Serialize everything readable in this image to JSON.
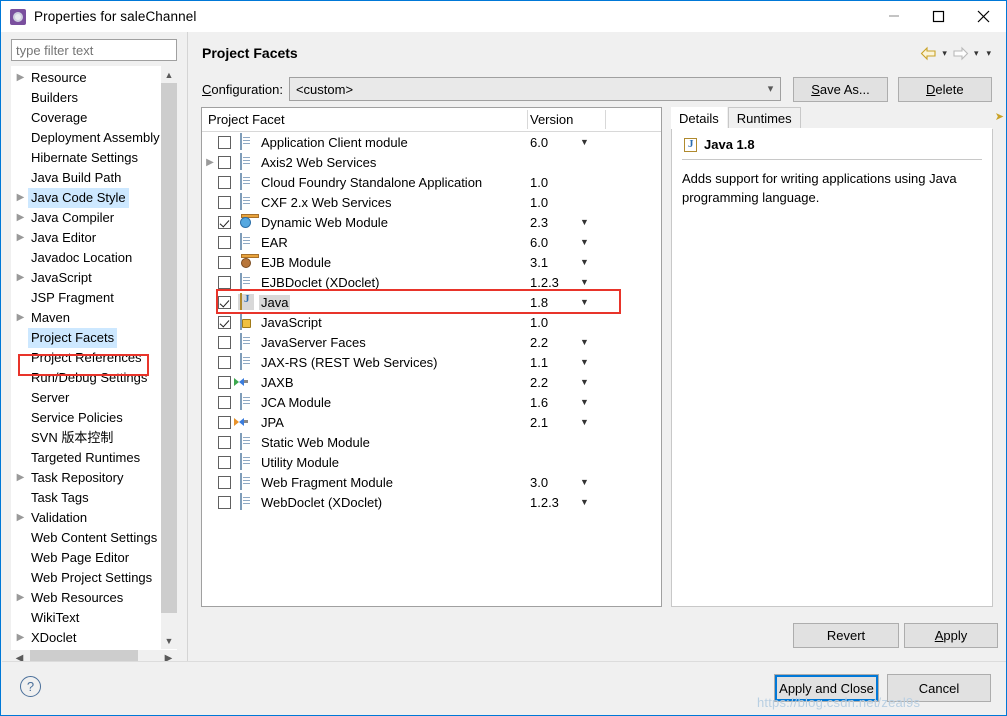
{
  "window": {
    "title": "Properties for saleChannel",
    "icon": "properties-gear-icon",
    "minimize": "minimize-icon",
    "maximize": "maximize-icon",
    "close": "close-icon"
  },
  "sidebar": {
    "filter_placeholder": "type filter text",
    "items": [
      {
        "label": "Resource",
        "expandable": true,
        "selected": false
      },
      {
        "label": "Builders",
        "expandable": false,
        "selected": false
      },
      {
        "label": "Coverage",
        "expandable": false,
        "selected": false
      },
      {
        "label": "Deployment Assembly",
        "expandable": false,
        "selected": false
      },
      {
        "label": "Hibernate Settings",
        "expandable": false,
        "selected": false
      },
      {
        "label": "Java Build Path",
        "expandable": false,
        "selected": false
      },
      {
        "label": "Java Code Style",
        "expandable": true,
        "selected": false,
        "highlight": true
      },
      {
        "label": "Java Compiler",
        "expandable": true,
        "selected": false
      },
      {
        "label": "Java Editor",
        "expandable": true,
        "selected": false
      },
      {
        "label": "Javadoc Location",
        "expandable": false,
        "selected": false
      },
      {
        "label": "JavaScript",
        "expandable": true,
        "selected": false
      },
      {
        "label": "JSP Fragment",
        "expandable": false,
        "selected": false
      },
      {
        "label": "Maven",
        "expandable": true,
        "selected": false
      },
      {
        "label": "Project Facets",
        "expandable": false,
        "selected": true
      },
      {
        "label": "Project References",
        "expandable": false,
        "selected": false
      },
      {
        "label": "Run/Debug Settings",
        "expandable": false,
        "selected": false
      },
      {
        "label": "Server",
        "expandable": false,
        "selected": false
      },
      {
        "label": "Service Policies",
        "expandable": false,
        "selected": false
      },
      {
        "label": "SVN 版本控制",
        "expandable": false,
        "selected": false
      },
      {
        "label": "Targeted Runtimes",
        "expandable": false,
        "selected": false
      },
      {
        "label": "Task Repository",
        "expandable": true,
        "selected": false
      },
      {
        "label": "Task Tags",
        "expandable": false,
        "selected": false
      },
      {
        "label": "Validation",
        "expandable": true,
        "selected": false
      },
      {
        "label": "Web Content Settings",
        "expandable": false,
        "selected": false
      },
      {
        "label": "Web Page Editor",
        "expandable": false,
        "selected": false
      },
      {
        "label": "Web Project Settings",
        "expandable": false,
        "selected": false
      },
      {
        "label": "Web Resources",
        "expandable": true,
        "selected": false
      },
      {
        "label": "WikiText",
        "expandable": false,
        "selected": false
      },
      {
        "label": "XDoclet",
        "expandable": true,
        "selected": false
      }
    ],
    "scroll_up_icon": "chevron-up-icon",
    "scroll_down_icon": "chevron-down-icon",
    "scroll_left_icon": "chevron-left-icon",
    "scroll_right_icon": "chevron-right-icon"
  },
  "page": {
    "title": "Project Facets",
    "back_icon": "back-arrow-icon",
    "forward_icon": "forward-arrow-icon",
    "menu_icon": "dropdown-menu-icon",
    "caret": "▾"
  },
  "configuration": {
    "label": "Configuration:",
    "label_mnemonic": "C",
    "value": "<custom>",
    "dropdown_icon": "chevron-down-icon",
    "save_as_label": "Save As...",
    "save_as_mnemonic": "S",
    "delete_label": "Delete",
    "delete_mnemonic": "D"
  },
  "facet_table": {
    "columns": [
      "Project Facet",
      "Version"
    ],
    "rows": [
      {
        "name": "Application Client module",
        "version": "6.0",
        "checked": false,
        "expandable": false,
        "dropdown": true,
        "icon": "doc-icon",
        "selected": false
      },
      {
        "name": "Axis2 Web Services",
        "version": "",
        "checked": false,
        "expandable": true,
        "dropdown": false,
        "icon": "doc-icon",
        "selected": false
      },
      {
        "name": "Cloud Foundry Standalone Application",
        "version": "1.0",
        "checked": false,
        "expandable": false,
        "dropdown": false,
        "icon": "doc-icon",
        "selected": false
      },
      {
        "name": "CXF 2.x Web Services",
        "version": "1.0",
        "checked": false,
        "expandable": false,
        "dropdown": false,
        "icon": "doc-icon",
        "selected": false
      },
      {
        "name": "Dynamic Web Module",
        "version": "2.3",
        "checked": true,
        "expandable": false,
        "dropdown": true,
        "icon": "web-module-icon",
        "selected": false
      },
      {
        "name": "EAR",
        "version": "6.0",
        "checked": false,
        "expandable": false,
        "dropdown": true,
        "icon": "doc-icon",
        "selected": false
      },
      {
        "name": "EJB Module",
        "version": "3.1",
        "checked": false,
        "expandable": false,
        "dropdown": true,
        "icon": "ejb-icon",
        "selected": false
      },
      {
        "name": "EJBDoclet (XDoclet)",
        "version": "1.2.3",
        "checked": false,
        "expandable": false,
        "dropdown": true,
        "icon": "doc-icon",
        "selected": false
      },
      {
        "name": "Java",
        "version": "1.8",
        "checked": true,
        "expandable": false,
        "dropdown": true,
        "icon": "java-icon",
        "selected": true
      },
      {
        "name": "JavaScript",
        "version": "1.0",
        "checked": true,
        "expandable": false,
        "dropdown": false,
        "icon": "javascript-icon",
        "selected": false
      },
      {
        "name": "JavaServer Faces",
        "version": "2.2",
        "checked": false,
        "expandable": false,
        "dropdown": true,
        "icon": "doc-icon",
        "selected": false
      },
      {
        "name": "JAX-RS (REST Web Services)",
        "version": "1.1",
        "checked": false,
        "expandable": false,
        "dropdown": true,
        "icon": "doc-icon",
        "selected": false
      },
      {
        "name": "JAXB",
        "version": "2.2",
        "checked": false,
        "expandable": false,
        "dropdown": true,
        "icon": "xml-binding-icon",
        "selected": false
      },
      {
        "name": "JCA Module",
        "version": "1.6",
        "checked": false,
        "expandable": false,
        "dropdown": true,
        "icon": "doc-icon",
        "selected": false
      },
      {
        "name": "JPA",
        "version": "2.1",
        "checked": false,
        "expandable": false,
        "dropdown": true,
        "icon": "jpa-icon",
        "selected": false
      },
      {
        "name": "Static Web Module",
        "version": "",
        "checked": false,
        "expandable": false,
        "dropdown": false,
        "icon": "doc-icon",
        "selected": false
      },
      {
        "name": "Utility Module",
        "version": "",
        "checked": false,
        "expandable": false,
        "dropdown": false,
        "icon": "doc-icon",
        "selected": false
      },
      {
        "name": "Web Fragment Module",
        "version": "3.0",
        "checked": false,
        "expandable": false,
        "dropdown": true,
        "icon": "doc-icon",
        "selected": false
      },
      {
        "name": "WebDoclet (XDoclet)",
        "version": "1.2.3",
        "checked": false,
        "expandable": false,
        "dropdown": true,
        "icon": "doc-icon",
        "selected": false
      }
    ]
  },
  "details": {
    "tabs": [
      {
        "label": "Details",
        "active": true
      },
      {
        "label": "Runtimes",
        "active": false
      }
    ],
    "heading": "Java 1.8",
    "heading_icon": "java-icon",
    "description": "Adds support for writing applications using Java programming language."
  },
  "buttons": {
    "revert": "Revert",
    "apply": "Apply",
    "apply_mnemonic": "A",
    "apply_and_close": "Apply and Close",
    "cancel": "Cancel",
    "help_icon": "help-icon"
  },
  "watermark": "https://blog.csdn.net/zeal9s",
  "colors": {
    "accent": "#0078d7",
    "annotation": "#e8342a",
    "selection": "#cde8ff",
    "row_selection": "#d8d8d8"
  }
}
